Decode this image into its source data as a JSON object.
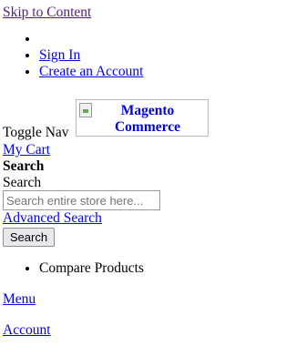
{
  "skip_link": "Skip to Content",
  "header_links": [
    "",
    "Sign In",
    "Create an Account"
  ],
  "toggle_nav": "Toggle Nav",
  "logo": {
    "alt_line1": "Magento",
    "alt_line2": "Commerce"
  },
  "cart_link": "My Cart",
  "search": {
    "heading": "Search",
    "label": "Search",
    "placeholder": "Search entire store here...",
    "advanced_link": "Advanced Search",
    "button_label": "Search"
  },
  "compare": {
    "label": "Compare Products"
  },
  "menu_link": "Menu",
  "account_link": "Account",
  "icons": {
    "logo": "broken-image-icon",
    "bullet": "disc-bullet"
  },
  "colors": {
    "link": "#0000ee",
    "visited": "#551a8b"
  }
}
